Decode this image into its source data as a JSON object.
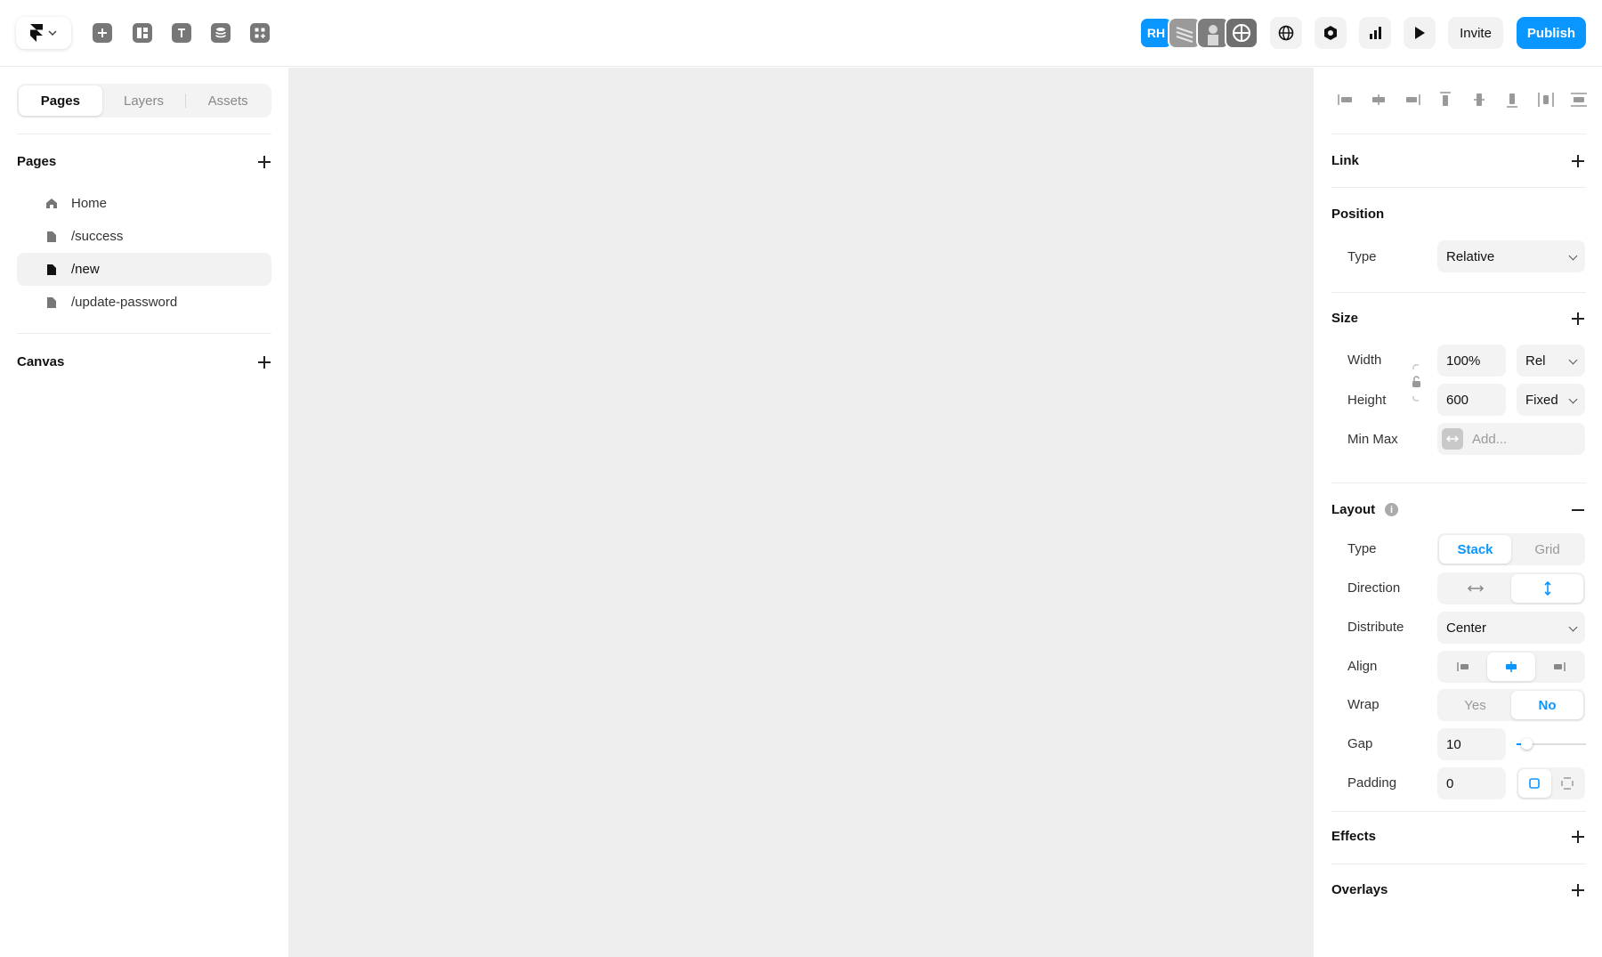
{
  "topbar": {
    "tools": [
      "insert-icon",
      "layout-icon",
      "text-icon",
      "cms-icon",
      "components-icon"
    ],
    "avatars": {
      "initials": "RH",
      "accent": "#0a96ff"
    },
    "invite_label": "Invite",
    "publish_label": "Publish"
  },
  "left_panel": {
    "tabs": [
      {
        "label": "Pages",
        "active": true
      },
      {
        "label": "Layers",
        "active": false
      },
      {
        "label": "Assets",
        "active": false
      }
    ],
    "pages_title": "Pages",
    "pages": [
      {
        "label": "Home",
        "icon": "home-icon",
        "selected": false
      },
      {
        "label": "/success",
        "icon": "page-icon",
        "selected": false
      },
      {
        "label": "/new",
        "icon": "page-icon",
        "selected": true
      },
      {
        "label": "/update-password",
        "icon": "page-icon",
        "selected": false
      }
    ],
    "canvas_title": "Canvas"
  },
  "right_panel": {
    "link_title": "Link",
    "position": {
      "title": "Position",
      "type_label": "Type",
      "type_value": "Relative"
    },
    "size": {
      "title": "Size",
      "width_label": "Width",
      "width_value": "100%",
      "width_unit": "Rel",
      "height_label": "Height",
      "height_value": "600",
      "height_unit": "Fixed",
      "minmax_label": "Min Max",
      "minmax_placeholder": "Add..."
    },
    "layout": {
      "title": "Layout",
      "type_label": "Type",
      "type_options": [
        "Stack",
        "Grid"
      ],
      "type_selected": "Stack",
      "direction_label": "Direction",
      "distribute_label": "Distribute",
      "distribute_value": "Center",
      "align_label": "Align",
      "wrap_label": "Wrap",
      "wrap_options": [
        "Yes",
        "No"
      ],
      "wrap_selected": "No",
      "gap_label": "Gap",
      "gap_value": "10",
      "padding_label": "Padding",
      "padding_value": "0"
    },
    "effects_title": "Effects",
    "overlays_title": "Overlays"
  }
}
